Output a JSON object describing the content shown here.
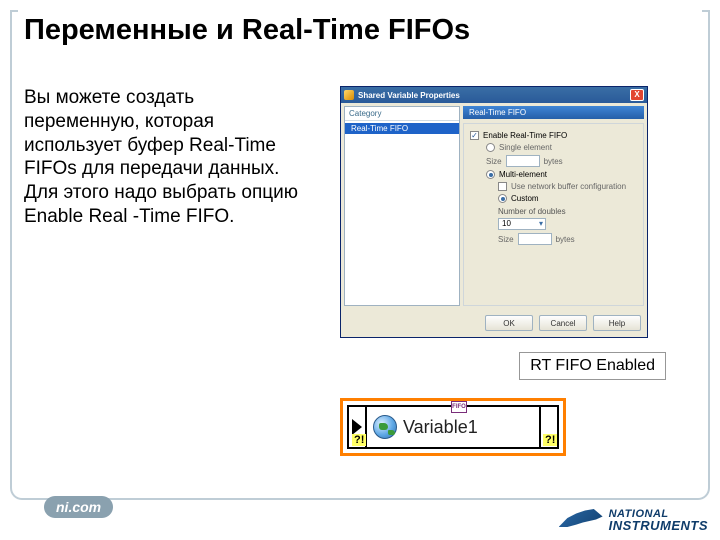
{
  "slide": {
    "title": "Переменные и Real-Time FIFOs",
    "body": "Вы можете создать переменную, которая использует буфер Real-Time FIFOs для передачи данных. Для этого надо выбрать опцию Enable Real -Time FIFO."
  },
  "dialog": {
    "title": "Shared Variable Properties",
    "close": "X",
    "left": {
      "header": "Category",
      "item": "Real-Time FIFO"
    },
    "right": {
      "header": "Real-Time FIFO",
      "enable_label": "Enable Real-Time FIFO",
      "single_label": "Single element",
      "size_label": "Size",
      "size_unit": "bytes",
      "multi_label": "Multi-element",
      "use_buf_label": "Use network buffer configuration",
      "custom_label": "Custom",
      "num_doubles_label": "Number of doubles",
      "num_doubles_value": "10",
      "array_size_label": "Size",
      "array_bytes": "bytes"
    },
    "buttons": {
      "ok": "OK",
      "cancel": "Cancel",
      "help": "Help"
    }
  },
  "callout": "RT FIFO Enabled",
  "bdnode": {
    "badge": "FIFO",
    "label": "Variable1",
    "excl": "?!"
  },
  "footer": {
    "nicom": "ni.com",
    "brand_top": "NATIONAL",
    "brand_bottom": "INSTRUMENTS"
  }
}
